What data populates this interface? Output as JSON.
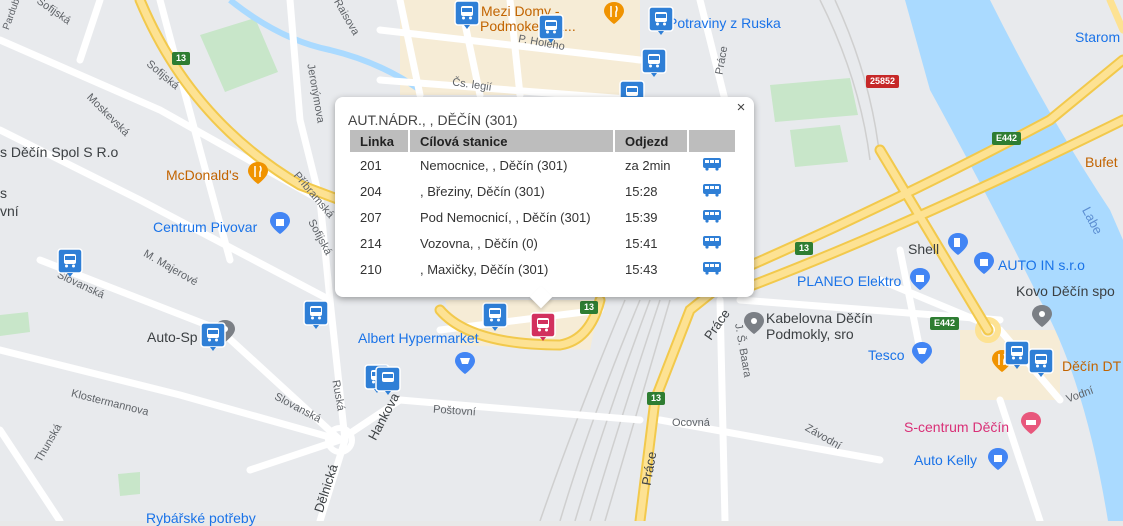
{
  "popup": {
    "title": "AUT.NÁDR., , DĚČÍN (301)",
    "headers": [
      "Linka",
      "Cílová stanice",
      "Odjezd",
      ""
    ],
    "rows": [
      {
        "line": "201",
        "dest": "Nemocnice, , Děčín (301)",
        "time": "za 2min"
      },
      {
        "line": "204",
        "dest": ", Březiny, Děčín (301)",
        "time": "15:28"
      },
      {
        "line": "207",
        "dest": "Pod Nemocnicí, , Děčín (301)",
        "time": "15:39"
      },
      {
        "line": "214",
        "dest": "Vozovna, , Děčín (0)",
        "time": "15:41"
      },
      {
        "line": "210",
        "dest": ", Maxičky, Děčín (301)",
        "time": "15:43"
      }
    ],
    "close_label": "×"
  },
  "map": {
    "pois": {
      "mezi_domy": "Mezi Domy -",
      "podmokelska": "Podmokelská...",
      "potraviny": "Potraviny z Ruska",
      "starom": "Starom",
      "spol": "s Děčín Spol S R.o",
      "mcdonalds": "McDonald's",
      "centrum_pivovar": "Centrum Pivovar",
      "auto_sp": "Auto-Sp",
      "albert": "Albert Hypermarket",
      "bufet": "Bufet",
      "shell": "Shell",
      "auto_in": "AUTO IN s.r.o",
      "planeo": "PLANEO Elektro",
      "kovo": "Kovo Děčín spo",
      "kabelovna": "Kabelovna Děčín",
      "podmokly_sro": "Podmokly, sro",
      "tesco": "Tesco",
      "decin_dt": "Děčín DT",
      "s_centrum": "S-centrum Děčín",
      "auto_kelly": "Auto Kelly",
      "rybarske": "Rybářské potřeby",
      "vni": "vní",
      "s_char": "s"
    },
    "streets": {
      "sofijska1": "Sofijská",
      "sofijska2": "Sofijská",
      "sofijska3": "Sofijská",
      "raisova": "Raisova",
      "p_holeho": "P. Holeho",
      "cs_legii": "Čs. legií",
      "moskevska": "Moskevská",
      "jeronymova": "Jeronýmova",
      "pribramska": "Příbramská",
      "m_majerove": "M. Majerové",
      "slovanska1": "Slovanská",
      "slovanska2": "Slovanská",
      "klostermannova": "Klostermannova",
      "ruska": "Ruská",
      "hankova": "Hankova",
      "delnicka": "Dělnická",
      "thunska": "Thunská",
      "postovni": "Poštovní",
      "ocovna": "Ocovná",
      "zavodni": "Závodní",
      "prace1": "Práce",
      "prace2": "Práce",
      "prace3": "Práce",
      "js_baara": "J. Š. Baara",
      "vodni": "Vodní",
      "labe": "Labe",
      "pardubicka": "Pardubická"
    },
    "shields": {
      "r13a": "13",
      "r13b": "13",
      "r13c": "13",
      "r13d": "13",
      "r25852": "25852",
      "e442a": "E442",
      "e442b": "E442"
    },
    "colors": {
      "transit_blue": "#2f7fd6",
      "selected_stop": "#d2305e",
      "major_road": "#fde293",
      "water": "#aadaff"
    }
  }
}
